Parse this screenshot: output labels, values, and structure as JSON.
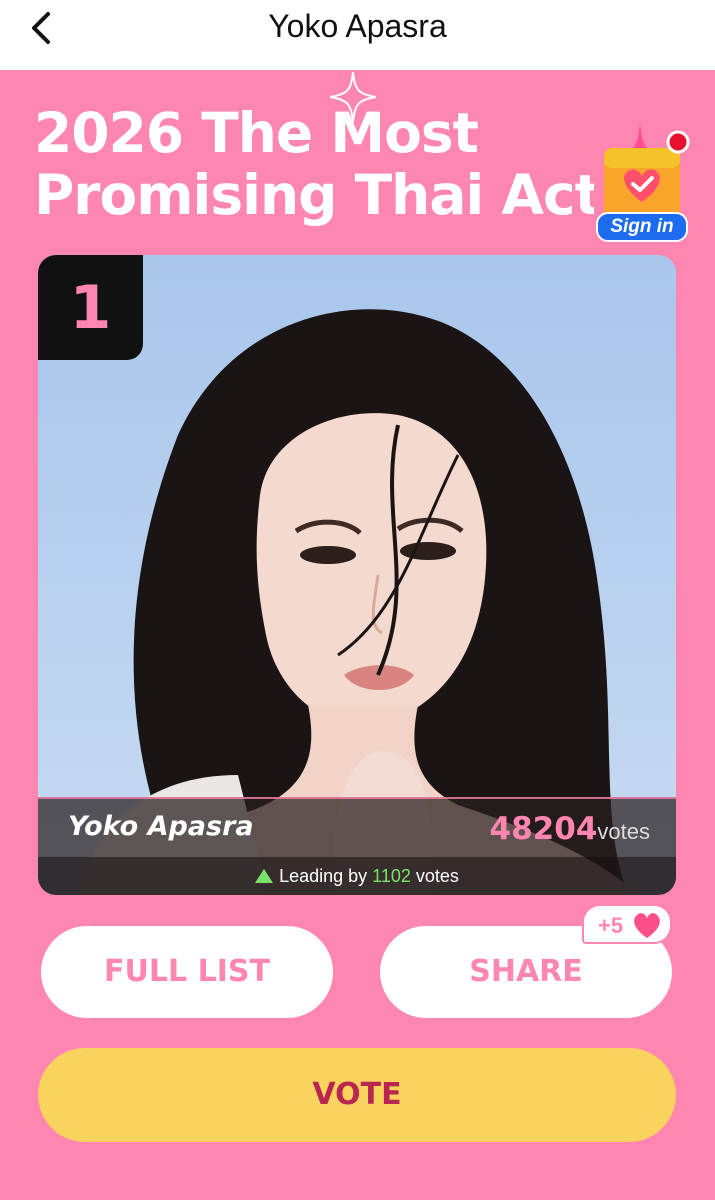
{
  "header": {
    "title": "Yoko Apasra",
    "back_icon": "chevron-left-icon"
  },
  "banner": {
    "headline_line1": "2026 The Most",
    "headline_line2": "Promising Thai Acto",
    "signin_label": "Sign in"
  },
  "candidate": {
    "rank": "1",
    "name": "Yoko Apasra",
    "vote_count": "48204",
    "votes_suffix": "votes",
    "leading_prefix": "Leading by",
    "leading_count": "1102",
    "leading_suffix": "votes"
  },
  "actions": {
    "full_list_label": "FULL LIST",
    "share_label": "SHARE",
    "share_bonus": "+5",
    "vote_label": "VOTE"
  },
  "colors": {
    "background": "#ff86b0",
    "vote_button": "#f9d35e",
    "vote_text": "#b9264f",
    "leading_green": "#7be36c"
  }
}
